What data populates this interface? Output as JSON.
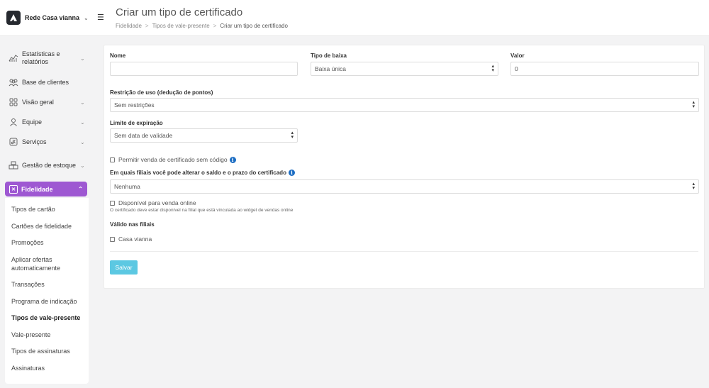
{
  "brand": {
    "name": "Rede Casa vianna"
  },
  "header": {
    "title": "Criar um tipo de certificado",
    "breadcrumb": [
      "Fidelidade",
      "Tipos de vale-presente",
      "Criar um tipo de certificado"
    ]
  },
  "sidebar": {
    "items": [
      {
        "label": "Estatísticas e relatórios",
        "icon": "chart-icon"
      },
      {
        "label": "Base de clientes",
        "icon": "users-icon"
      },
      {
        "label": "Visão geral",
        "icon": "grid-icon"
      },
      {
        "label": "Equipe",
        "icon": "user-icon"
      },
      {
        "label": "Serviços",
        "icon": "scissors-icon"
      },
      {
        "label": "Gestão de estoque",
        "icon": "boxes-icon"
      }
    ],
    "active": {
      "label": "Fidelidade",
      "icon": "loyalty-icon"
    },
    "sub_items": [
      "Tipos de cartão",
      "Cartões de fidelidade",
      "Promoções",
      "Aplicar ofertas automaticamente",
      "Transações",
      "Programa de indicação",
      "Tipos de vale-presente",
      "Vale-presente",
      "Tipos de assinaturas",
      "Assinaturas"
    ]
  },
  "form": {
    "nome": {
      "label": "Nome",
      "value": ""
    },
    "tipo_baixa": {
      "label": "Tipo de baixa",
      "value": "Baixa única"
    },
    "valor": {
      "label": "Valor",
      "value": "0"
    },
    "restricao": {
      "label": "Restrição de uso (dedução de pontos)",
      "value": "Sem restrições"
    },
    "limite": {
      "label": "Limite de expiração",
      "value": "Sem data de validade"
    },
    "permitir_venda": {
      "label": "Permitir venda de certificado sem código"
    },
    "filiais_alterar": {
      "label": "Em quais filiais você pode alterar o saldo e o prazo do certificado",
      "value": "Nenhuma"
    },
    "venda_online": {
      "label": "Disponível para venda online",
      "hint": "O certificado deve estar disponível na filial que está vinculada ao widget de vendas online"
    },
    "valido_filiais": {
      "label": "Válido nas filiais",
      "option": "Casa vianna"
    },
    "save_label": "Salvar"
  }
}
